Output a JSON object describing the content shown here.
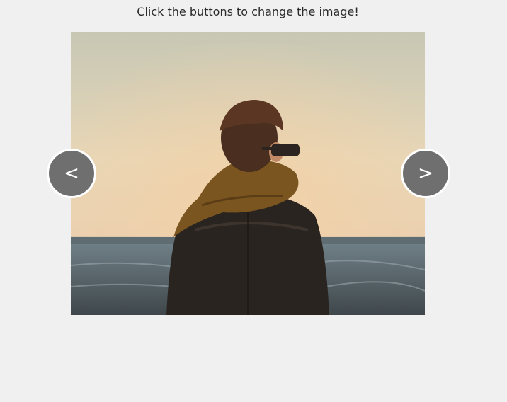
{
  "instruction": "Click the buttons to change the image!",
  "slider": {
    "prev_label": "<",
    "next_label": ">",
    "image_description_icon": "photo-person-by-sea-icon"
  },
  "colors": {
    "background": "#f0f0f0",
    "button_fill": "#6f6f6f",
    "button_border": "#ffffff"
  }
}
